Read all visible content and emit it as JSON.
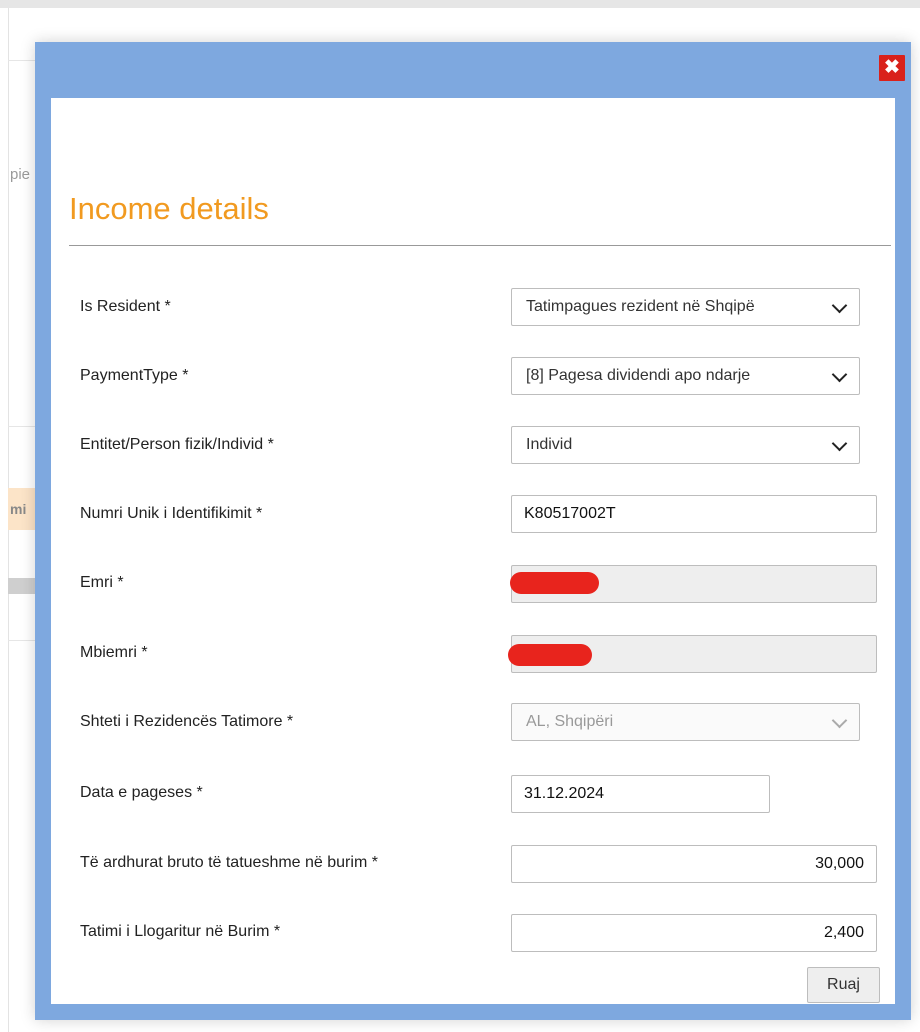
{
  "background": {
    "fragment_left_text": "pie",
    "fragment_tab_text": "mi"
  },
  "dialog": {
    "close_label": "✖",
    "title": "Income details",
    "fields": {
      "is_resident": {
        "label": "Is Resident *",
        "value": "Tatimpagues rezident në Shqipë"
      },
      "payment_type": {
        "label": "PaymentType *",
        "value": "[8] Pagesa dividendi apo ndarje"
      },
      "entity_type": {
        "label": "Entitet/Person fizik/Individ *",
        "value": "Individ"
      },
      "nuis": {
        "label": "Numri Unik i Identifikimit *",
        "value": "K80517002T"
      },
      "first_name": {
        "label": "Emri *",
        "value": ""
      },
      "last_name": {
        "label": "Mbiemri *",
        "value": ""
      },
      "tax_residence_country": {
        "label": "Shteti i Rezidencës Tatimore *",
        "value": "AL, Shqipëri"
      },
      "payment_date": {
        "label": "Data e pageses *",
        "value": "31.12.2024"
      },
      "gross_income": {
        "label": "Të ardhurat bruto të tatueshme në burim *",
        "value": "30,000"
      },
      "withheld_tax": {
        "label": "Tatimi i Llogaritur në Burim *",
        "value": "2,400"
      }
    },
    "save_label": "Ruaj"
  },
  "colors": {
    "dialog_border": "#7ea8df",
    "title": "#f19a20",
    "close_button": "#d9211b",
    "redaction": "#e8241d"
  }
}
